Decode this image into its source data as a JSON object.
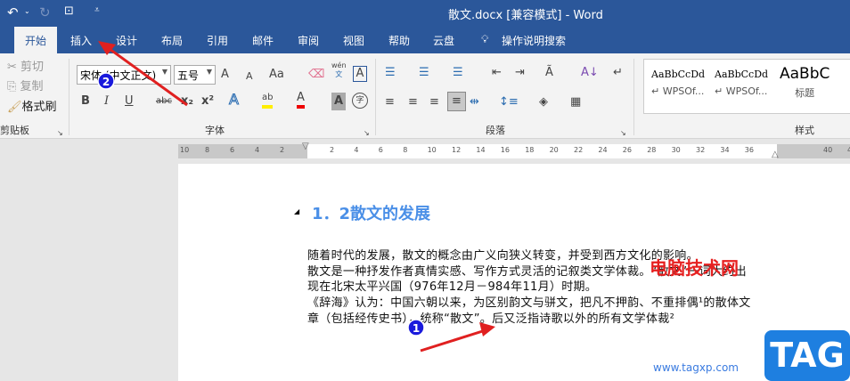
{
  "titlebar": {
    "title": "散文.docx [兼容模式]  -  Word"
  },
  "tabs": [
    {
      "label": "开始"
    },
    {
      "label": "插入"
    },
    {
      "label": "设计"
    },
    {
      "label": "布局"
    },
    {
      "label": "引用"
    },
    {
      "label": "邮件"
    },
    {
      "label": "审阅"
    },
    {
      "label": "视图"
    },
    {
      "label": "帮助"
    },
    {
      "label": "云盘"
    },
    {
      "label": "操作说明搜索"
    }
  ],
  "clipboard": {
    "cut": "剪切",
    "copy": "复制",
    "format_painter": "格式刷",
    "label": "剪贴板"
  },
  "font": {
    "name": "宋体 (中文正文)",
    "size": "五号",
    "label": "字体",
    "grow": "A",
    "shrink": "A",
    "case": "Aa",
    "pinyin_top": "wén",
    "pinyin_bottom": "文",
    "border_char": "A",
    "bold": "B",
    "italic": "I",
    "underline": "U",
    "strike": "abc",
    "sub": "x₂",
    "sup": "x²",
    "effects": "A",
    "highlight": "ab",
    "color": "A",
    "shade": "A",
    "enclose": "字"
  },
  "paragraph": {
    "label": "段落"
  },
  "styles": {
    "label": "样式",
    "items": [
      {
        "preview": "AaBbCcDd",
        "name": "↵ WPSOf..."
      },
      {
        "preview": "AaBbCcDd",
        "name": "↵ WPSOf..."
      },
      {
        "preview": "AaBbC",
        "name": "标题"
      }
    ]
  },
  "ruler": {
    "left": [
      "10",
      "8",
      "6",
      "4",
      "2"
    ],
    "right": [
      "2",
      "4",
      "6",
      "8",
      "10",
      "12",
      "14",
      "16",
      "18",
      "20",
      "22",
      "24",
      "26",
      "28",
      "30",
      "32",
      "34",
      "36"
    ],
    "margin": [
      "40",
      "42"
    ]
  },
  "document": {
    "heading": "1．2散文的发展",
    "lines": [
      "随着时代的发展，散文的概念由广义向狭义转变，并受到西方文化的影响。",
      "散文是一种抒发作者真情实感、写作方式灵活的记叙类文学体裁。“散文”一词大约出",
      "现在北宋太平兴国（976年12月－984年11月）时期。",
      "《辞海》认为：中国六朝以来，为区别韵文与骈文，把凡不押韵、不重排偶¹的散体文",
      "章（包括经传史书），统称“散文”。后又泛指诗歌以外的所有文学体裁²"
    ]
  },
  "annotations": {
    "badge1": "1",
    "badge2": "2",
    "arrow_color": "#e02020",
    "badge_color": "#1a1adc"
  },
  "watermark": {
    "site": "电脑技术网",
    "url": "www.tagxp.com",
    "logo": "TAG"
  },
  "colors": {
    "brand": "#2b579a",
    "heading": "#4a8fe7"
  }
}
